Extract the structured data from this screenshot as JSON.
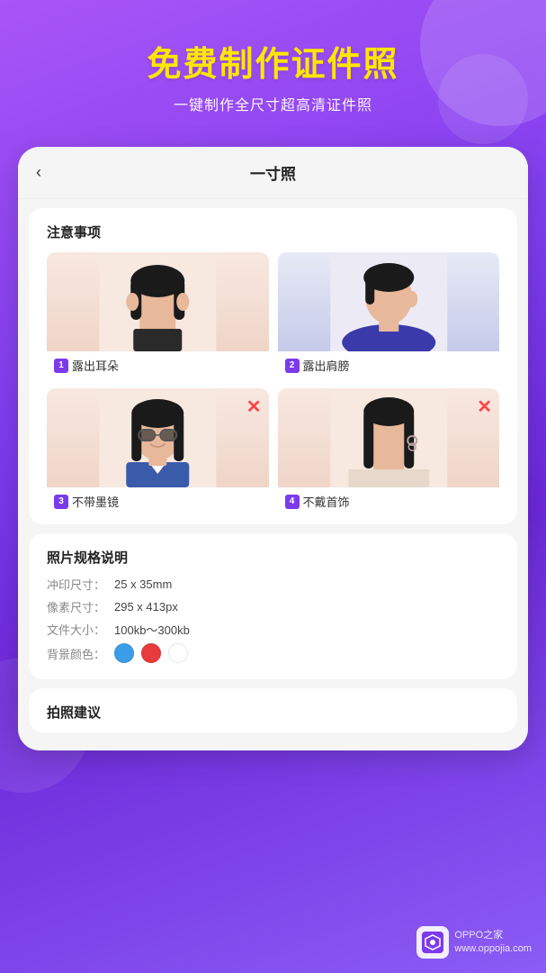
{
  "background": {
    "gradient_start": "#a855f7",
    "gradient_end": "#6d28d9"
  },
  "header": {
    "title": "免费制作证件照",
    "subtitle": "一键制作全尺寸超高清证件照"
  },
  "card": {
    "back_label": "‹",
    "title": "一寸照",
    "notice_title": "注意事项",
    "items": [
      {
        "num": "1",
        "label": "露出耳朵",
        "good": true
      },
      {
        "num": "2",
        "label": "露出肩膀",
        "good": true
      },
      {
        "num": "3",
        "label": "不带墨镜",
        "good": false
      },
      {
        "num": "4",
        "label": "不戴首饰",
        "good": false
      }
    ],
    "specs": {
      "title": "照片规格说明",
      "rows": [
        {
          "label": "冲印尺寸：",
          "value": "25 x 35mm"
        },
        {
          "label": "像素尺寸：",
          "value": "295 x 413px"
        },
        {
          "label": "文件大小：",
          "value": "100kb～300kb"
        },
        {
          "label": "背景颜色：",
          "value": ""
        }
      ],
      "colors": [
        "#3b9de8",
        "#e83b3b",
        "#ffffff"
      ]
    },
    "suggest": {
      "title": "拍照建议"
    }
  },
  "watermark": {
    "site": "OPPO之家",
    "url": "www.oppojia.com"
  }
}
